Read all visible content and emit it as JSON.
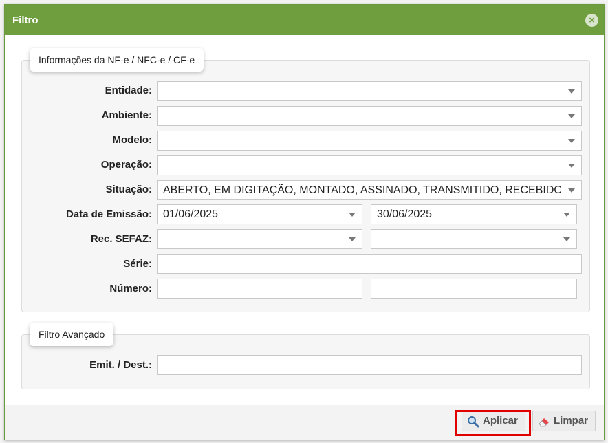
{
  "dialog": {
    "title": "Filtro",
    "close_icon": "×"
  },
  "section_info": {
    "legend": "Informações da NF-e / NFC-e / CF-e",
    "fields": {
      "entidade": {
        "label": "Entidade:",
        "value": ""
      },
      "ambiente": {
        "label": "Ambiente:",
        "value": ""
      },
      "modelo": {
        "label": "Modelo:",
        "value": ""
      },
      "operacao": {
        "label": "Operação:",
        "value": ""
      },
      "situacao": {
        "label": "Situação:",
        "value": "ABERTO, EM DIGITAÇÃO, MONTADO, ASSINADO, TRANSMITIDO, RECEBIDO"
      },
      "data_emissao": {
        "label": "Data de Emissão:",
        "from": "01/06/2025",
        "to": "30/06/2025"
      },
      "rec_sefaz": {
        "label": "Rec. SEFAZ:",
        "from": "",
        "to": ""
      },
      "serie": {
        "label": "Série:",
        "value": ""
      },
      "numero": {
        "label": "Número:",
        "from": "",
        "to": ""
      }
    }
  },
  "section_advanced": {
    "legend": "Filtro Avançado",
    "fields": {
      "emit_dest": {
        "label": "Emit. / Dest.:",
        "value": ""
      }
    }
  },
  "footer": {
    "apply_label": "Aplicar",
    "apply_icon": "magnifier-icon",
    "clear_label": "Limpar",
    "clear_icon": "eraser-icon"
  },
  "colors": {
    "titlebar": "#6f9e3f",
    "highlight": "#e00000"
  }
}
